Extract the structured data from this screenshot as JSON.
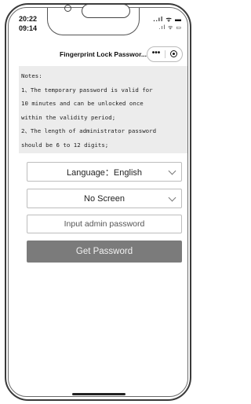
{
  "status": {
    "time_primary": "20:22",
    "time_secondary": "09:14",
    "icons_primary": "..ıl ᯤ ▬",
    "icons_secondary": ".ıl ᯤ ▭"
  },
  "header": {
    "title": "Fingerprint Lock Passwor...",
    "more_label": "•••"
  },
  "notes": {
    "lines": [
      "Notes:",
      "1、The temporary password is valid for",
      "10 minutes and can be unlocked once",
      "within the validity period;",
      "2、The length of administrator password",
      "should be 6 to 12 digits;"
    ]
  },
  "form": {
    "language_label": "Language：English",
    "screen_label": "No Screen",
    "password_placeholder": "Input admin password",
    "password_value": "",
    "submit_label": "Get Password"
  },
  "colors": {
    "notes_bg": "#ececec",
    "button_bg": "#7b7b7b"
  }
}
